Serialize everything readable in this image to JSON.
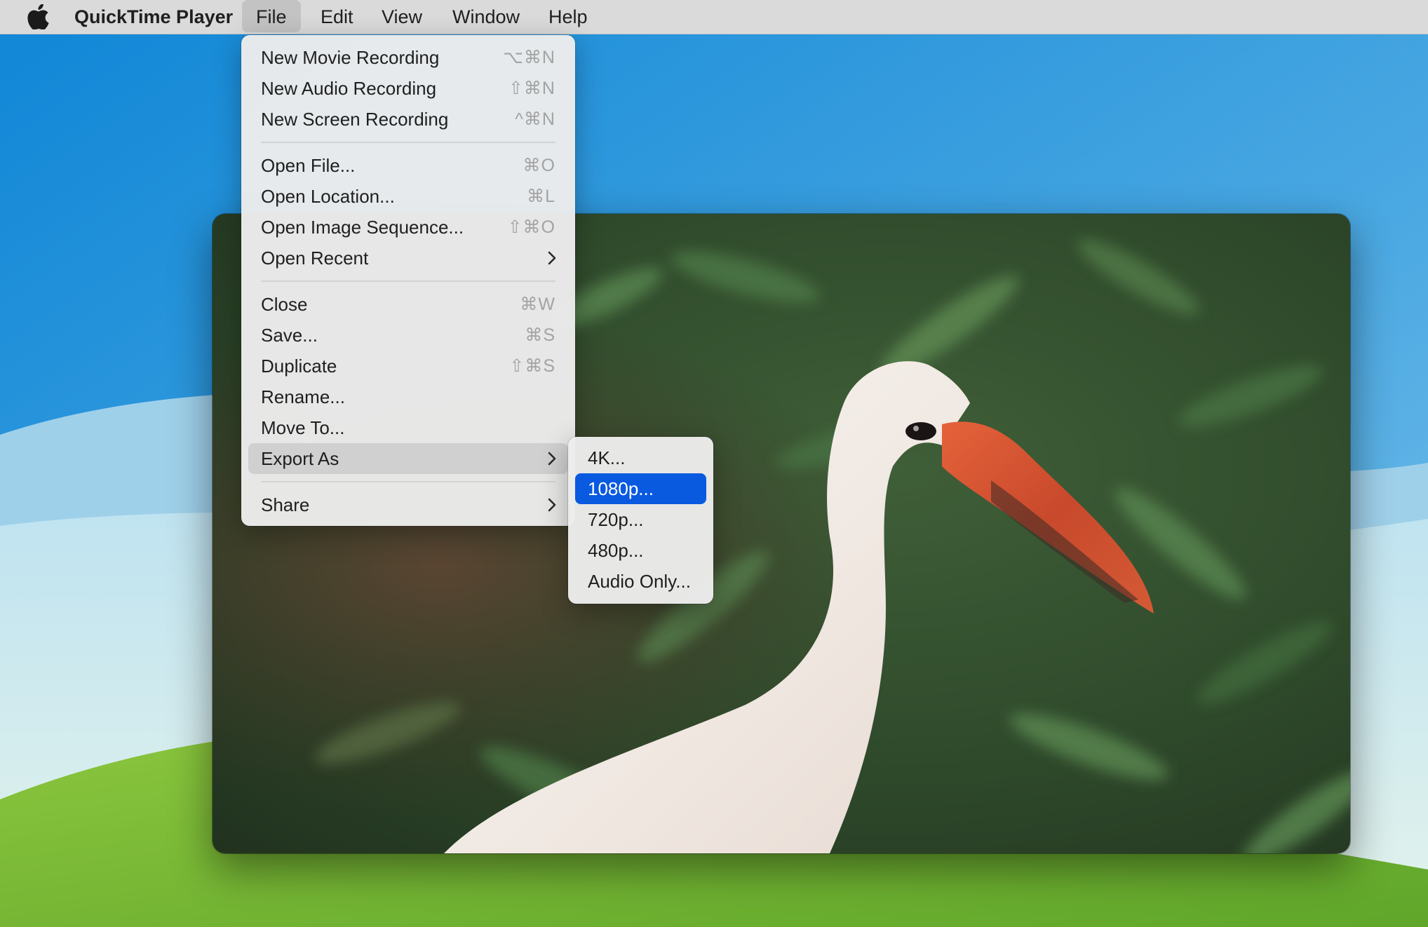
{
  "menubar": {
    "app_name": "QuickTime Player",
    "menus": [
      "File",
      "Edit",
      "View",
      "Window",
      "Help"
    ]
  },
  "file_menu": {
    "items": [
      {
        "label": "New Movie Recording",
        "shortcut": "⌥⌘N"
      },
      {
        "label": "New Audio Recording",
        "shortcut": "⇧⌘N"
      },
      {
        "label": "New Screen Recording",
        "shortcut": "^⌘N"
      },
      {
        "label": "Open File...",
        "shortcut": "⌘O"
      },
      {
        "label": "Open Location...",
        "shortcut": "⌘L"
      },
      {
        "label": "Open Image Sequence...",
        "shortcut": "⇧⌘O"
      },
      {
        "label": "Open Recent",
        "submenu": true
      },
      {
        "label": "Close",
        "shortcut": "⌘W"
      },
      {
        "label": "Save...",
        "shortcut": "⌘S"
      },
      {
        "label": "Duplicate",
        "shortcut": "⇧⌘S"
      },
      {
        "label": "Rename..."
      },
      {
        "label": "Move To..."
      },
      {
        "label": "Export As",
        "submenu": true,
        "state": "open"
      },
      {
        "label": "Share",
        "submenu": true
      }
    ]
  },
  "export_submenu": {
    "items": [
      {
        "label": "4K..."
      },
      {
        "label": "1080p...",
        "state": "selected"
      },
      {
        "label": "720p..."
      },
      {
        "label": "480p..."
      },
      {
        "label": "Audio Only..."
      }
    ]
  },
  "colors": {
    "menu_bg": "#ececec",
    "highlight_blue": "#0a5ae0",
    "submenu_open_bg": "#d0d0d0",
    "shortcut_gray": "#a3a3a3"
  },
  "icons": [
    "apple-logo",
    "chevron-right-icon"
  ]
}
